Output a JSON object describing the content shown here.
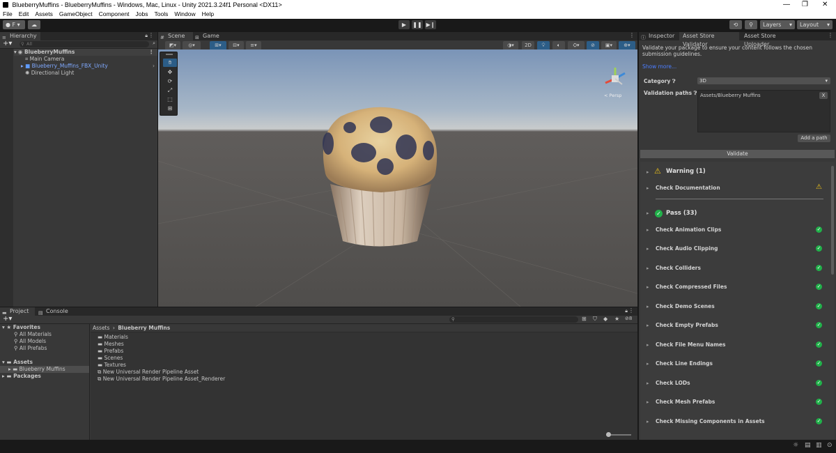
{
  "window": {
    "title": "BlueberryMuffins - BlueberryMuffins - Windows, Mac, Linux - Unity 2021.3.24f1 Personal <DX11>"
  },
  "menu": [
    "File",
    "Edit",
    "Assets",
    "GameObject",
    "Component",
    "Jobs",
    "Tools",
    "Window",
    "Help"
  ],
  "toolbar": {
    "account": "F",
    "layers": "Layers",
    "layout": "Layout"
  },
  "hierarchy": {
    "tab": "Hierarchy",
    "search_placeholder": "All",
    "scene": "BlueberryMuffins",
    "items": [
      "Main Camera",
      "Blueberry_Muffins_FBX_Unity",
      "Directional Light"
    ]
  },
  "scene_tabs": [
    "Scene",
    "Game"
  ],
  "scene_toolbar": {
    "view2d": "2D"
  },
  "gizmo": {
    "label": "< Persp"
  },
  "project": {
    "tabs": [
      "Project",
      "Console"
    ],
    "favorites": "Favorites",
    "favorite_items": [
      "All Materials",
      "All Models",
      "All Prefabs"
    ],
    "assets": "Assets",
    "asset_folder": "Blueberry Muffins",
    "packages": "Packages",
    "breadcrumb": [
      "Assets",
      "Blueberry Muffins"
    ],
    "files": [
      "Materials",
      "Meshes",
      "Prefabs",
      "Scenes",
      "Textures",
      "New Universal Render Pipeline Asset",
      "New Universal Render Pipeline Asset_Renderer"
    ],
    "hidden_count": "8"
  },
  "inspector": {
    "tabs": [
      "Inspector",
      "Asset Store Validator",
      "Asset Store Uploader"
    ],
    "description": "Validate your package to ensure your content follows the chosen submission guidelines.",
    "show_more": "Show more...",
    "category_label": "Category",
    "category_value": "3D",
    "paths_label": "Validation paths",
    "path_value": "Assets/Blueberry Muffins",
    "remove_path": "X",
    "add_path": "Add a path",
    "validate": "Validate",
    "warning_header": "Warning (1)",
    "warning_items": [
      "Check Documentation"
    ],
    "pass_header": "Pass (33)",
    "pass_items": [
      "Check Animation Clips",
      "Check Audio Clipping",
      "Check Colliders",
      "Check Compressed Files",
      "Check Demo Scenes",
      "Check Empty Prefabs",
      "Check File Menu Names",
      "Check Line Endings",
      "Check LODs",
      "Check Mesh Prefabs",
      "Check Missing Components in Assets"
    ]
  },
  "colors": {
    "accent": "#2c5d87",
    "pass": "#21b14a",
    "warning": "#f0c419",
    "link": "#4c7eff"
  }
}
